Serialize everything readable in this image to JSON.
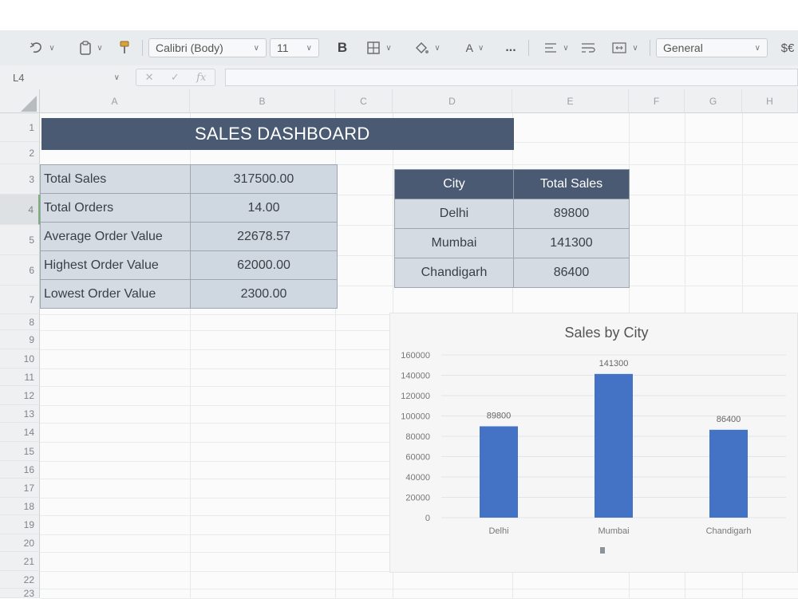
{
  "toolbar": {
    "font_name": "Calibri (Body)",
    "font_size": "11",
    "bold_label": "B",
    "font_color_label": "A",
    "more_label": "...",
    "number_format": "General",
    "currency_label": "$€",
    "icons": [
      "undo-icon",
      "clipboard-icon",
      "format-painter-icon",
      "borders-icon",
      "fill-color-icon",
      "align-icon",
      "wrap-text-icon",
      "merge-icon"
    ]
  },
  "formula_bar": {
    "name_box": "L4",
    "fx_label": "fx",
    "value": ""
  },
  "columns": [
    "A",
    "B",
    "C",
    "D",
    "E",
    "F",
    "G",
    "H"
  ],
  "rows": [
    "1",
    "2",
    "3",
    "4",
    "5",
    "6",
    "7",
    "8",
    "9",
    "10",
    "11",
    "12",
    "13",
    "14",
    "15",
    "16",
    "17",
    "18",
    "19",
    "20",
    "21",
    "22",
    "23"
  ],
  "dashboard": {
    "title": "SALES DASHBOARD",
    "kpis": [
      {
        "label": "Total Sales",
        "value": "317500.00"
      },
      {
        "label": "Total Orders",
        "value": "14.00"
      },
      {
        "label": "Average Order Value",
        "value": "22678.57"
      },
      {
        "label": "Highest Order Value",
        "value": "62000.00"
      },
      {
        "label": "Lowest Order Value",
        "value": "2300.00"
      }
    ]
  },
  "city_table": {
    "headers": [
      "City",
      "Total Sales"
    ],
    "rows": [
      [
        "Delhi",
        "89800"
      ],
      [
        "Mumbai",
        "141300"
      ],
      [
        "Chandigarh",
        "86400"
      ]
    ]
  },
  "chart_data": {
    "type": "bar",
    "title": "Sales by City",
    "categories": [
      "Delhi",
      "Mumbai",
      "Chandigarh"
    ],
    "values": [
      89800,
      141300,
      86400
    ],
    "data_labels": [
      "89800",
      "141300",
      "86400"
    ],
    "ylim": [
      0,
      160000
    ],
    "yticks": [
      "0",
      "20000",
      "40000",
      "60000",
      "80000",
      "100000",
      "120000",
      "140000",
      "160000"
    ],
    "xlabel": "",
    "ylabel": "",
    "grid": true,
    "legend": "none",
    "bar_color": "#4472c4"
  },
  "colors": {
    "header_fill": "#4a5a72",
    "cell_fill": "#d4dbe3",
    "accent_bar": "#4472c4"
  }
}
